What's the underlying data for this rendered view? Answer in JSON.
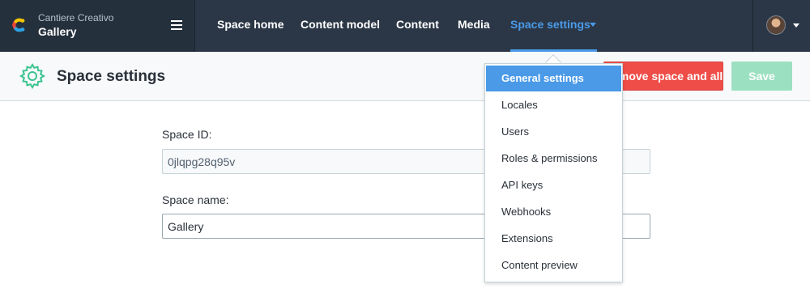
{
  "org": {
    "name": "Cantiere Creativo",
    "space": "Gallery"
  },
  "nav": {
    "items": [
      "Space home",
      "Content model",
      "Content",
      "Media",
      "Space settings"
    ],
    "active": "Space settings"
  },
  "header": {
    "title": "Space settings",
    "delete_label": "Remove space and all its contents",
    "save_label": "Save"
  },
  "form": {
    "space_id_label": "Space ID:",
    "space_id_value": "0jlqpg28q95v",
    "space_name_label": "Space name:",
    "space_name_value": "Gallery"
  },
  "dropdown": {
    "items": [
      "General settings",
      "Locales",
      "Users",
      "Roles & permissions",
      "API keys",
      "Webhooks",
      "Extensions",
      "Content preview"
    ],
    "selected": "General settings"
  },
  "colors": {
    "accent": "#4a9ae8",
    "topbar": "#2b3746",
    "danger": "#ef4d47",
    "save_disabled": "#9be0c1",
    "gear": "#3bc48f"
  },
  "icons": [
    "contentful-logo-icon",
    "hamburger-menu-icon",
    "chevron-down-icon",
    "gear-icon",
    "avatar"
  ]
}
